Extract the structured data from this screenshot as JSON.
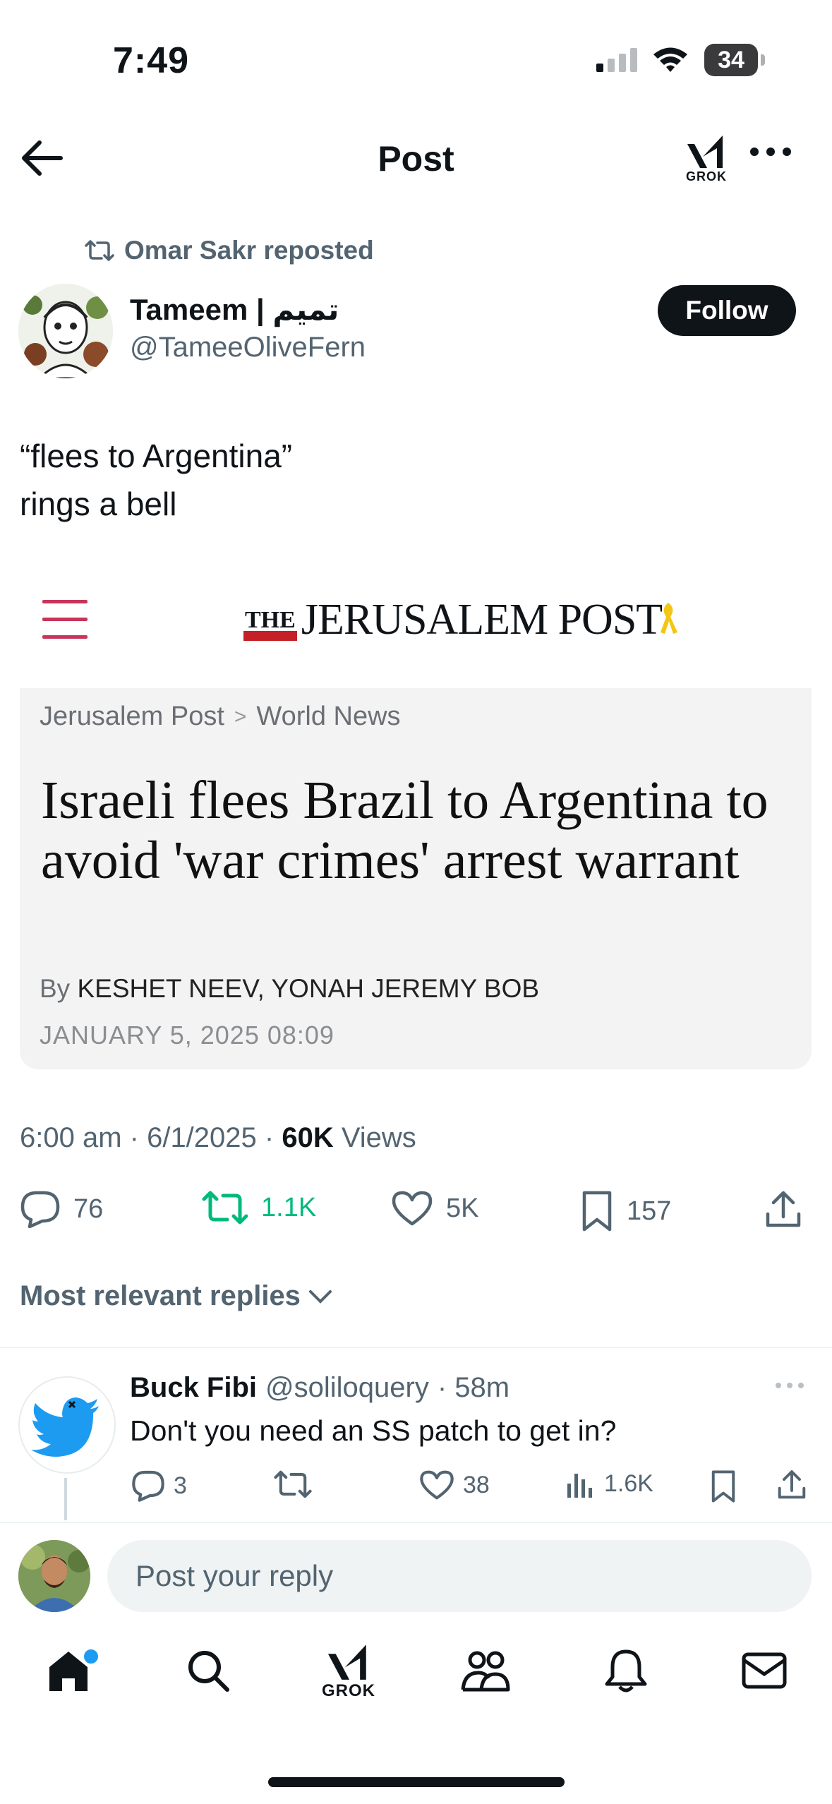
{
  "status_bar": {
    "time": "7:49",
    "battery": "34"
  },
  "nav": {
    "title": "Post",
    "grok_label": "GROK"
  },
  "repost": {
    "text": "Omar Sakr reposted"
  },
  "author": {
    "name": "Tameem | تميم",
    "handle": "@TameeOliveFern",
    "follow_label": "Follow"
  },
  "post": {
    "text_line1": "“flees to Argentina”",
    "text_line2": "rings a bell"
  },
  "article": {
    "logo_the": "THE",
    "logo_main": "JERUSALEM POST",
    "breadcrumb_1": "Jerusalem Post",
    "breadcrumb_sep": ">",
    "breadcrumb_2": "World News",
    "headline": "Israeli flees Brazil to Argentina to avoid 'war crimes' arrest warrant",
    "by": "By",
    "authors": "KESHET NEEV, YONAH JEREMY BOB",
    "date": "JANUARY 5, 2025 08:09"
  },
  "meta": {
    "time": "6:00 am · 6/1/2025 · ",
    "views_count": "60K",
    "views_label": " Views"
  },
  "stats": {
    "replies": "76",
    "reposts": "1.1K",
    "likes": "5K",
    "bookmarks": "157"
  },
  "replies_filter": {
    "label": "Most relevant replies"
  },
  "reply": {
    "name": "Buck Fibi",
    "handle": "@soliloquery",
    "age": "· 58m",
    "text": "Don't you need an SS patch to get in?",
    "replies": "3",
    "likes": "38",
    "views": "1.6K"
  },
  "compose": {
    "placeholder": "Post your reply"
  },
  "tabbar": {
    "grok_label": "GROK"
  },
  "colors": {
    "accent": "#1d9bf0",
    "repost_green": "#00ba7c",
    "text_secondary": "#536471",
    "jp_red": "#c32127"
  },
  "icons": [
    "back-arrow-icon",
    "grok-icon",
    "more-icon",
    "repost-icon",
    "reply-icon",
    "like-icon",
    "bookmark-icon",
    "share-icon",
    "views-icon",
    "home-icon",
    "search-icon",
    "communities-icon",
    "bell-icon",
    "mail-icon"
  ]
}
